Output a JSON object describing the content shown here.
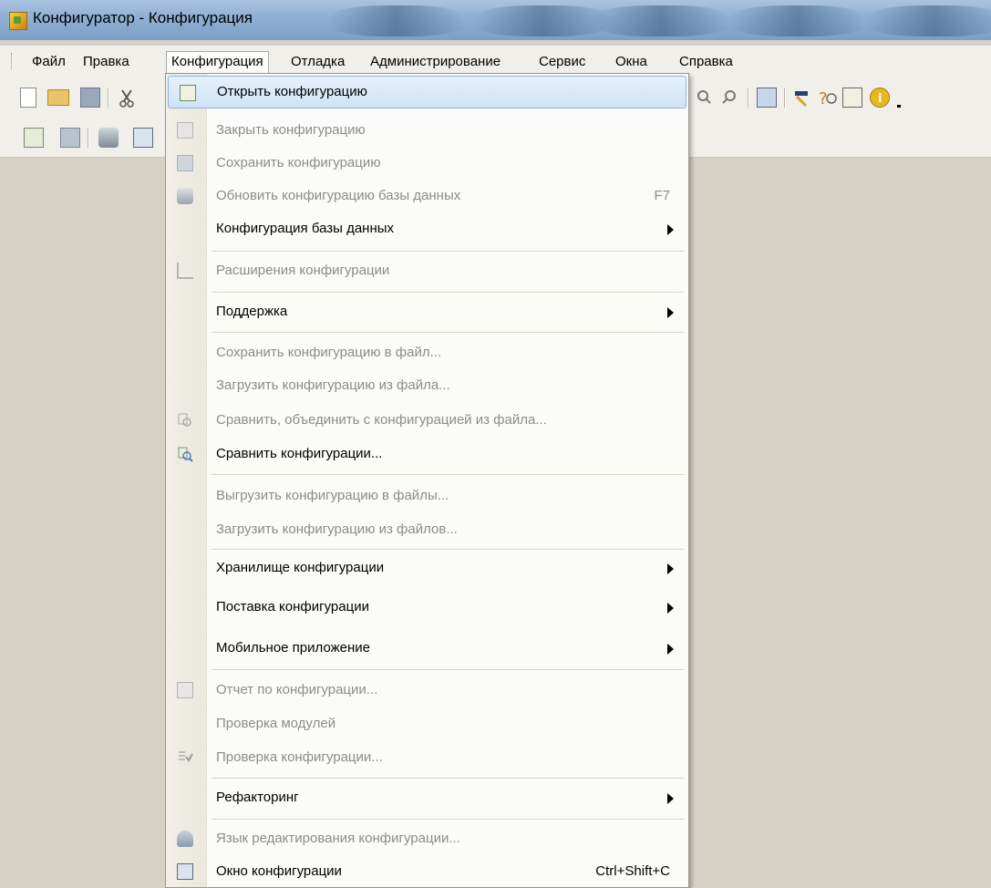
{
  "window": {
    "title": "Конфигуратор - Конфигурация"
  },
  "menubar": {
    "items": [
      {
        "label": "Файл"
      },
      {
        "label": "Правка"
      },
      {
        "label": "Конфигурация"
      },
      {
        "label": "Отладка"
      },
      {
        "label": "Администрирование"
      },
      {
        "label": "Сервис"
      },
      {
        "label": "Окна"
      },
      {
        "label": "Справка"
      }
    ],
    "active_item": "Конфигурация"
  },
  "toolbar": {
    "row1_icons": [
      "new-file-icon",
      "open-file-icon",
      "save-icon",
      "cut-icon"
    ],
    "row1_right_icons": [
      "search-icon",
      "search-prev-icon",
      "window-icon",
      "wizard-icon",
      "syntax-helper-icon",
      "docs-icon",
      "info-icon"
    ],
    "row2_icons": [
      "config-window-icon",
      "save-config-icon",
      "db-update-icon",
      "table-icon"
    ]
  },
  "menu": {
    "items": [
      {
        "label": "Открыть конфигурацию",
        "enabled": true,
        "hover": true,
        "icon": "open-config-icon"
      },
      {
        "label": "Закрыть конфигурацию",
        "enabled": false,
        "icon": "close-config-icon"
      },
      {
        "label": "Сохранить конфигурацию",
        "enabled": false,
        "icon": "save-config-icon"
      },
      {
        "label": "Обновить конфигурацию базы данных",
        "enabled": false,
        "icon": "db-update-icon",
        "shortcut": "F7"
      },
      {
        "label": "Конфигурация базы данных",
        "enabled": true,
        "submenu": true
      },
      {
        "label": "Расширения конфигурации",
        "enabled": false,
        "icon": "extensions-icon"
      },
      {
        "label": "Поддержка",
        "enabled": true,
        "submenu": true
      },
      {
        "label": "Сохранить конфигурацию в файл...",
        "enabled": false
      },
      {
        "label": "Загрузить конфигурацию из файла...",
        "enabled": false
      },
      {
        "label": "Сравнить, объединить с конфигурацией из файла...",
        "enabled": false,
        "icon": "compare-merge-icon"
      },
      {
        "label": "Сравнить конфигурации...",
        "enabled": true,
        "icon": "compare-icon"
      },
      {
        "label": "Выгрузить конфигурацию в файлы...",
        "enabled": false
      },
      {
        "label": "Загрузить конфигурацию из файлов...",
        "enabled": false
      },
      {
        "label": "Хранилище конфигурации",
        "enabled": true,
        "submenu": true
      },
      {
        "label": "Поставка конфигурации",
        "enabled": true,
        "submenu": true
      },
      {
        "label": "Мобильное приложение",
        "enabled": true,
        "submenu": true
      },
      {
        "label": "Отчет по конфигурации...",
        "enabled": false,
        "icon": "report-icon"
      },
      {
        "label": "Проверка модулей",
        "enabled": false
      },
      {
        "label": "Проверка конфигурации...",
        "enabled": false,
        "icon": "check-config-icon"
      },
      {
        "label": "Рефакторинг",
        "enabled": true,
        "submenu": true
      },
      {
        "label": "Язык редактирования конфигурации...",
        "enabled": false,
        "icon": "language-icon"
      },
      {
        "label": "Окно конфигурации",
        "enabled": true,
        "icon": "config-window-icon",
        "shortcut": "Ctrl+Shift+C"
      }
    ]
  },
  "colors": {
    "menu_bg": "#fbfbf7",
    "disabled_text": "#8c8c8c",
    "hover_border": "#8db2e3",
    "workspace_bg": "#d6d2c5"
  }
}
